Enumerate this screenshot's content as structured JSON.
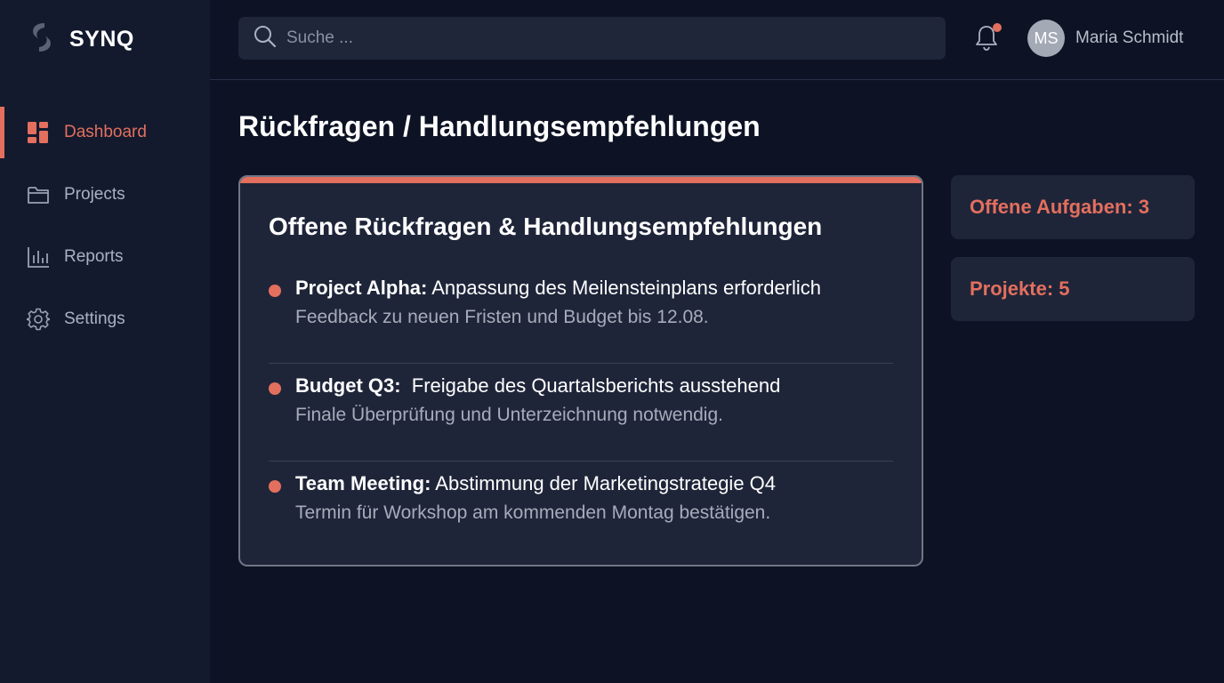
{
  "brand": {
    "name": "SYNQ"
  },
  "sidebar": {
    "items": [
      {
        "label": "Dashboard",
        "icon": "dashboard-icon",
        "active": true
      },
      {
        "label": "Projects",
        "icon": "folder-icon",
        "active": false
      },
      {
        "label": "Reports",
        "icon": "bar-chart-icon",
        "active": false
      },
      {
        "label": "Settings",
        "icon": "gear-icon",
        "active": false
      }
    ]
  },
  "topbar": {
    "search": {
      "placeholder": "Suche ..."
    },
    "notification": {
      "icon": "bell-icon",
      "has_unread": true
    },
    "user": {
      "initials": "MS",
      "name": "Maria Schmidt"
    }
  },
  "main": {
    "page_title": "Rückfragen / Handlungsempfehlungen",
    "card": {
      "title": "Offene Rückfragen & Handlungsempfehlungen",
      "items": [
        {
          "heading": "Project Alpha:",
          "summary": "Anpassung des Meilensteinplans erforderlich",
          "detail": "Feedback zu neuen Fristen und Budget bis 12.08."
        },
        {
          "heading": "Budget Q3:",
          "summary": "Freigabe des Quartalsberichts ausstehend",
          "detail": "Finale Überprüfung und Unterzeichnung notwendig."
        },
        {
          "heading": "Team Meeting:",
          "summary": "Abstimmung der Marketingstrategie Q4",
          "detail": "Termin für Workshop am kommenden Montag bestätigen."
        }
      ]
    },
    "stats": [
      {
        "label": "Offene Aufgaben: 3"
      },
      {
        "label": "Projekte: 5"
      }
    ]
  },
  "colors": {
    "accent": "#e36f5e",
    "background": "#0d1324",
    "sidebar": "#131a2e",
    "card": "#1f2539"
  }
}
